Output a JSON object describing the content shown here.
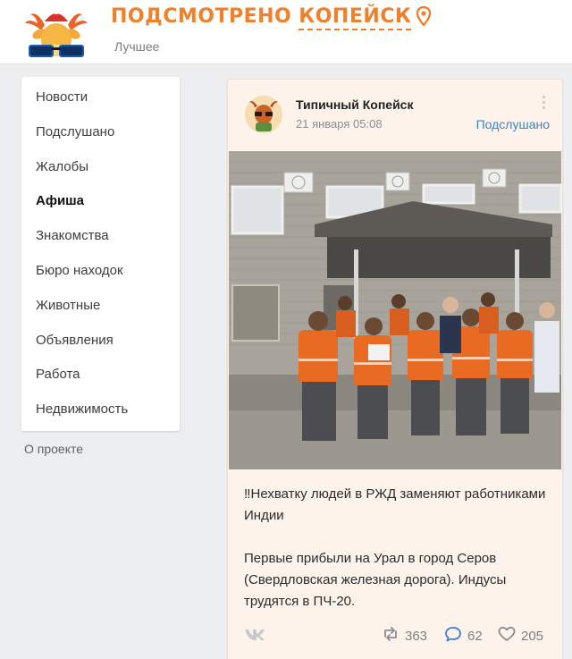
{
  "header": {
    "brand_first": "ПОДСМОТРЕНО",
    "brand_city": "КОПЕЙСК",
    "subtitle": "Лучшее",
    "accent": "#f0802c",
    "icons": [
      "logo-deer-glasses",
      "location-pin-icon"
    ]
  },
  "sidebar": {
    "items": [
      {
        "label": "Новости"
      },
      {
        "label": "Подслушано"
      },
      {
        "label": "Жалобы"
      },
      {
        "label": "Афиша"
      },
      {
        "label": "Знакомства"
      },
      {
        "label": "Бюро находок"
      },
      {
        "label": "Животные"
      },
      {
        "label": "Объявления"
      },
      {
        "label": "Работа"
      },
      {
        "label": "Недвижимость"
      }
    ],
    "active": "Афиша",
    "about": "О проекте"
  },
  "post": {
    "author": "Типичный Копейск",
    "date": "21 января 05:08",
    "tag": "Подслушано",
    "tag_color": "#3a83c9",
    "text_line1": "‼Нехватку людей в РЖД заменяют работниками Индии",
    "text_line2": "Первые прибыли на Урал в город Серов (Свердловская железная дорога). Индусы трудятся в ПЧ-20.",
    "stats": {
      "reposts": "363",
      "comments": "62",
      "likes": "205"
    },
    "icons": [
      "vk-icon",
      "repost-icon",
      "comment-icon",
      "heart-icon",
      "more-dots-icon"
    ]
  }
}
